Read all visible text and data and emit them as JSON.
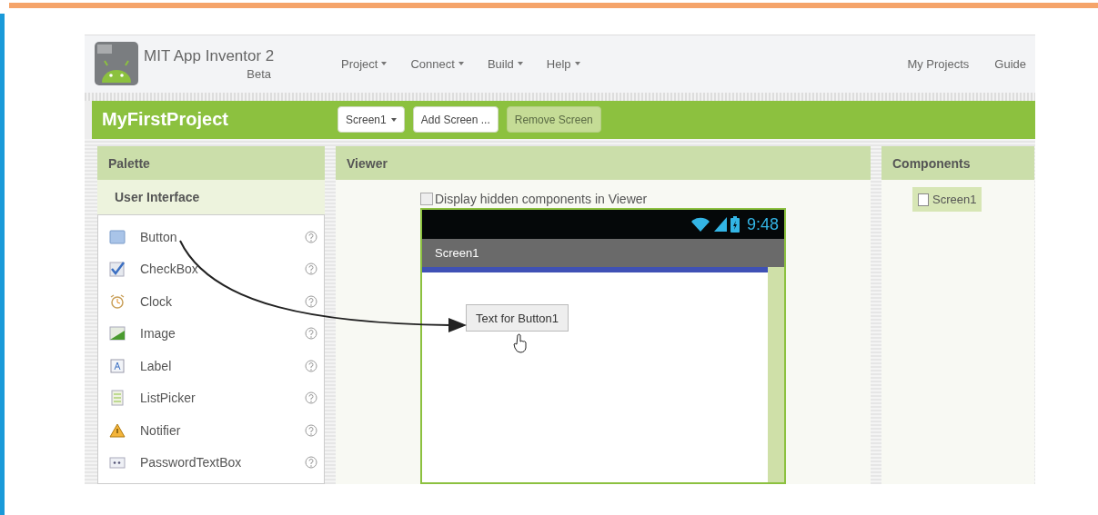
{
  "header": {
    "title": "MIT App Inventor 2",
    "subtitle": "Beta",
    "menus": [
      {
        "label": "Project"
      },
      {
        "label": "Connect"
      },
      {
        "label": "Build"
      },
      {
        "label": "Help"
      }
    ],
    "links": [
      "My Projects",
      "Guide"
    ]
  },
  "project_bar": {
    "name": "MyFirstProject",
    "buttons": [
      {
        "label": "Screen1",
        "dropdown": true,
        "disabled": false
      },
      {
        "label": "Add Screen ...",
        "dropdown": false,
        "disabled": false
      },
      {
        "label": "Remove Screen",
        "dropdown": false,
        "disabled": true
      }
    ]
  },
  "palette": {
    "title": "Palette",
    "section": "User Interface",
    "items": [
      {
        "label": "Button",
        "kind": "button"
      },
      {
        "label": "CheckBox",
        "kind": "checkbox"
      },
      {
        "label": "Clock",
        "kind": "clock"
      },
      {
        "label": "Image",
        "kind": "image"
      },
      {
        "label": "Label",
        "kind": "label"
      },
      {
        "label": "ListPicker",
        "kind": "listpicker"
      },
      {
        "label": "Notifier",
        "kind": "notifier"
      },
      {
        "label": "PasswordTextBox",
        "kind": "password"
      }
    ]
  },
  "viewer": {
    "title": "Viewer",
    "hidden_checkbox": {
      "label": "Display hidden components in Viewer",
      "checked": false
    },
    "phone": {
      "time": "9:48",
      "screen_title": "Screen1",
      "button_text": "Text for Button1"
    }
  },
  "components": {
    "title": "Components",
    "items": [
      {
        "label": "Screen1",
        "selected": true
      }
    ]
  }
}
